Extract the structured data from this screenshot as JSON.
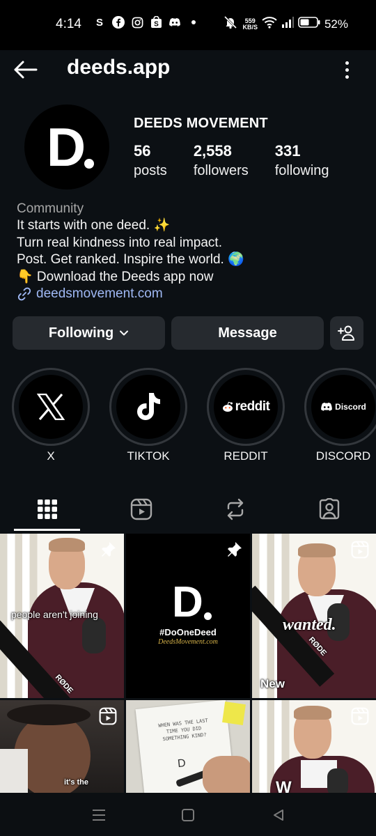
{
  "status_bar": {
    "time": "4:14",
    "net_speed_value": "559",
    "net_speed_unit": "KB/S",
    "battery": "52%",
    "left_icons": [
      "s-icon",
      "facebook-icon",
      "instagram-icon",
      "shop-icon",
      "discord-icon",
      "dot-icon"
    ],
    "right_icons": [
      "mute-icon",
      "wifi-icon",
      "signal-icon",
      "battery-icon"
    ]
  },
  "header": {
    "username": "deeds.app"
  },
  "profile": {
    "avatar_letter": "D",
    "display_name": "DEEDS MOVEMENT",
    "stats": [
      {
        "value": "56",
        "label": "posts"
      },
      {
        "value": "2,558",
        "label": "followers"
      },
      {
        "value": "331",
        "label": "following"
      }
    ],
    "bio": {
      "category": "Community",
      "lines": [
        "It starts with one deed. ✨",
        "Turn real kindness into real impact.",
        "Post. Get ranked. Inspire the world. 🌍",
        "👇 Download the Deeds app now"
      ],
      "link": "deedsmovement.com"
    }
  },
  "actions": {
    "following_label": "Following",
    "message_label": "Message"
  },
  "highlights": [
    {
      "label": "X",
      "icon": "x-logo-icon"
    },
    {
      "label": "TIKTOK",
      "icon": "tiktok-logo-icon"
    },
    {
      "label": "REDDIT",
      "icon": "reddit-logo-icon",
      "text": "reddit"
    },
    {
      "label": "DISCORD",
      "icon": "discord-logo-icon",
      "text": "Discord"
    }
  ],
  "tabs": [
    "grid-tab",
    "reels-tab",
    "reposts-tab",
    "tagged-tab"
  ],
  "grid": {
    "posts": [
      {
        "overlay": "people aren't joining",
        "badge": "pin-icon",
        "mic_label": "RØDE"
      },
      {
        "logo": "D",
        "hashtag": "#DoOneDeed",
        "site": "DeedsMovement.com",
        "badge": "pin-icon"
      },
      {
        "overlay": "wanted.",
        "footer": "New",
        "badge": "reel-icon",
        "mic_label": "RØDE"
      },
      {
        "overlay": "it's the",
        "badge": "reel-icon"
      },
      {
        "note": "WHEN WAS THE LAST TIME YOU DID SOMETHING KIND?"
      },
      {
        "overlay": "W",
        "badge": "reel-icon"
      }
    ]
  },
  "colors": {
    "background": "#0c1014",
    "button": "#262a2f",
    "link": "#a0b9f5",
    "secondary_text": "#a8a8a8"
  }
}
